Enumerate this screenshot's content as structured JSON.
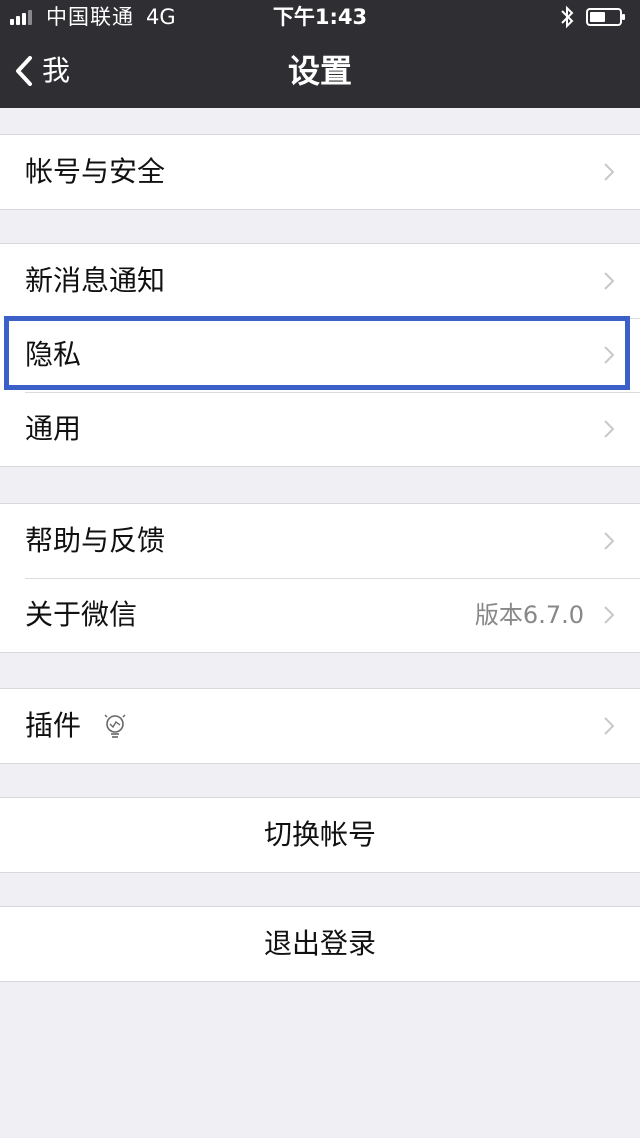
{
  "status_bar": {
    "carrier": "中国联通",
    "network": "4G",
    "time": "下午1:43"
  },
  "nav": {
    "back_label": "我",
    "title": "设置"
  },
  "groups": {
    "account": {
      "items": [
        {
          "label": "帐号与安全"
        }
      ]
    },
    "preferences": {
      "items": [
        {
          "label": "新消息通知"
        },
        {
          "label": "隐私"
        },
        {
          "label": "通用"
        }
      ]
    },
    "about": {
      "items": [
        {
          "label": "帮助与反馈"
        },
        {
          "label": "关于微信",
          "value": "版本6.7.0"
        }
      ]
    },
    "plugins": {
      "items": [
        {
          "label": "插件"
        }
      ]
    }
  },
  "actions": {
    "switch_account": "切换帐号",
    "logout": "退出登录"
  },
  "colors": {
    "nav_background": "#2f2f33",
    "page_background": "#efeff4",
    "highlight_border": "#3b60c8"
  },
  "icons": {
    "back": "chevron-left-icon",
    "disclosure": "chevron-right-icon",
    "plugin": "lightbulb-icon",
    "bluetooth": "bluetooth-icon",
    "battery": "battery-icon",
    "signal": "signal-icon"
  }
}
